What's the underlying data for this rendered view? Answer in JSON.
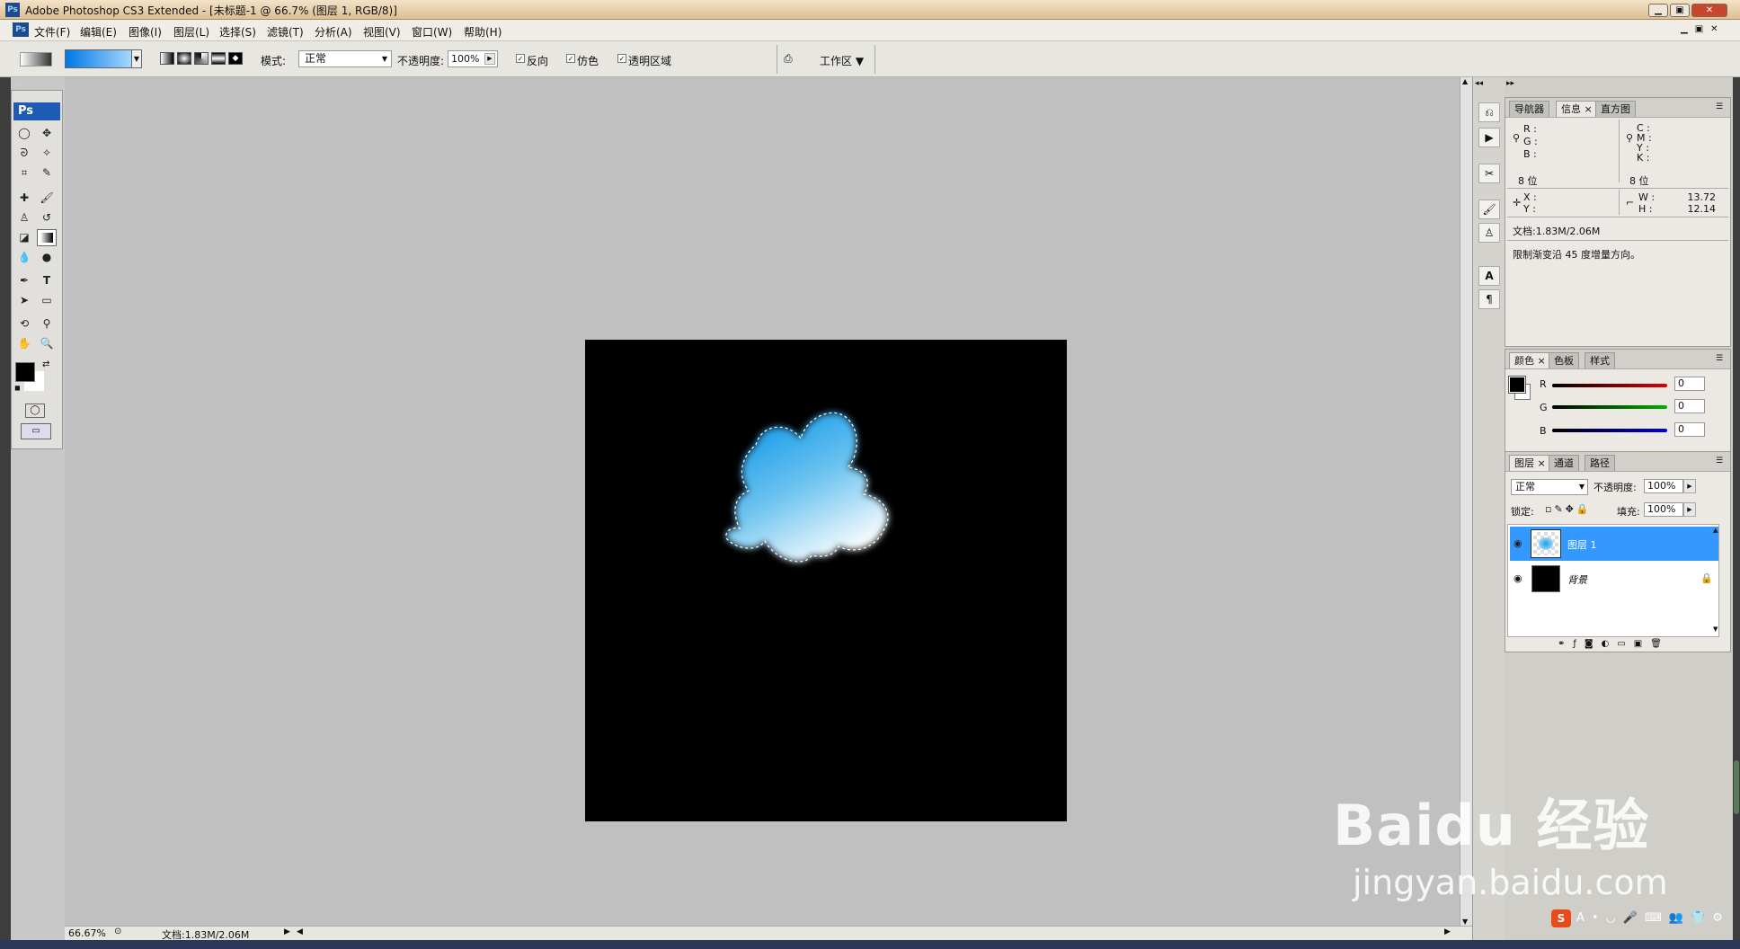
{
  "titlebar": {
    "title": "Adobe Photoshop CS3 Extended - [未标题-1 @ 66.7% (图层 1, RGB/8)]",
    "ps_icon": "Ps"
  },
  "menu": [
    "文件(F)",
    "编辑(E)",
    "图像(I)",
    "图层(L)",
    "选择(S)",
    "滤镜(T)",
    "分析(A)",
    "视图(V)",
    "窗口(W)",
    "帮助(H)"
  ],
  "options": {
    "mode_label": "模式:",
    "mode_value": "正常",
    "opacity_label": "不透明度:",
    "opacity_value": "100%",
    "reverse_label": "反向",
    "reverse_checked": true,
    "dither_label": "仿色",
    "dither_checked": true,
    "transparency_label": "透明区域",
    "transparency_checked": true,
    "workspace_label": "工作区 ▼",
    "gradient_colors": [
      "#0077e6",
      "#bfe6ff"
    ]
  },
  "toolbox": {
    "header": "Ps",
    "fg_color": "#000000",
    "bg_color": "#ffffff"
  },
  "status": {
    "zoom": "66.67%",
    "doc": "文档:1.83M/2.06M"
  },
  "info_panel": {
    "tabs": [
      "导航器",
      "信息",
      "直方图"
    ],
    "rgb_labels": [
      "R :",
      "G :",
      "B :"
    ],
    "cmyk_labels": [
      "C :",
      "M :",
      "Y :",
      "K :"
    ],
    "bits_left": "8 位",
    "bits_right": "8 位",
    "x_label": "X :",
    "y_label": "Y :",
    "w_label": "W :",
    "h_label": "H :",
    "w_value": "13.72",
    "h_value": "12.14",
    "doc_size": "文档:1.83M/2.06M",
    "hint": "限制渐变沿 45 度增量方向。"
  },
  "color_panel": {
    "tabs": [
      "颜色",
      "色板",
      "样式"
    ],
    "channels": [
      {
        "label": "R",
        "value": "0",
        "color": "#e00000"
      },
      {
        "label": "G",
        "value": "0",
        "color": "#00b000"
      },
      {
        "label": "B",
        "value": "0",
        "color": "#0000e0"
      }
    ]
  },
  "layers_panel": {
    "tabs": [
      "图层",
      "通道",
      "路径"
    ],
    "blend_mode": "正常",
    "opacity_label": "不透明度:",
    "opacity_value": "100%",
    "lock_label": "锁定:",
    "fill_label": "填充:",
    "fill_value": "100%",
    "layers": [
      {
        "name": "图层 1",
        "selected": true
      },
      {
        "name": "背景",
        "selected": false,
        "locked": true
      }
    ]
  },
  "watermark": {
    "brand": "Baidu 经验",
    "url": "jingyan.baidu.com"
  },
  "accent_color": "#3399ff"
}
